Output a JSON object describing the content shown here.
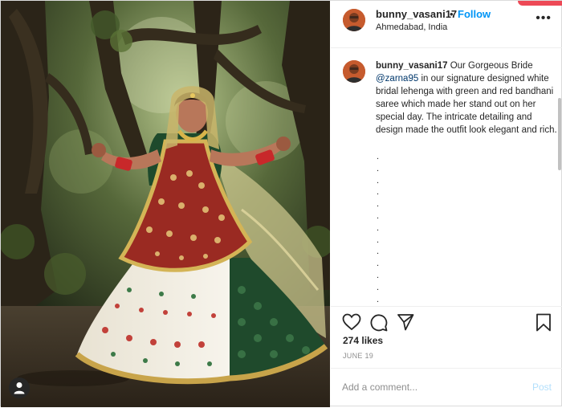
{
  "post": {
    "username": "bunny_vasani17",
    "separator": "•",
    "follow_label": "Follow",
    "location": "Ahmedabad, India",
    "more_icon": "more-horizontal-icon"
  },
  "caption": {
    "username": "bunny_vasani17",
    "text_before_mention": "Our Gorgeous Bride",
    "mention": "@zarna95",
    "text_after_mention": "in our signature designed white bridal lehenga with green and red bandhani saree which made her stand out on her special day. The intricate detailing and design made the outfit look elegant and rich.",
    "dots": [
      ".",
      ".",
      ".",
      ".",
      ".",
      ".",
      ".",
      ".",
      ".",
      ".",
      ".",
      ".",
      "."
    ]
  },
  "actions": {
    "like_icon": "heart-icon",
    "comment_icon": "comment-icon",
    "share_icon": "share-icon",
    "save_icon": "bookmark-icon"
  },
  "likes": "274 likes",
  "date": "JUNE 19",
  "comment_box": {
    "placeholder": "Add a comment...",
    "post_label": "Post",
    "post_color": "#b2dffc"
  },
  "colors": {
    "follow_blue": "#0095f6",
    "mention_blue": "#00376b",
    "border": "#dbdbdb",
    "top_accent": "#ed4956"
  },
  "photo": {
    "tag_icon": "user-tag-icon"
  }
}
